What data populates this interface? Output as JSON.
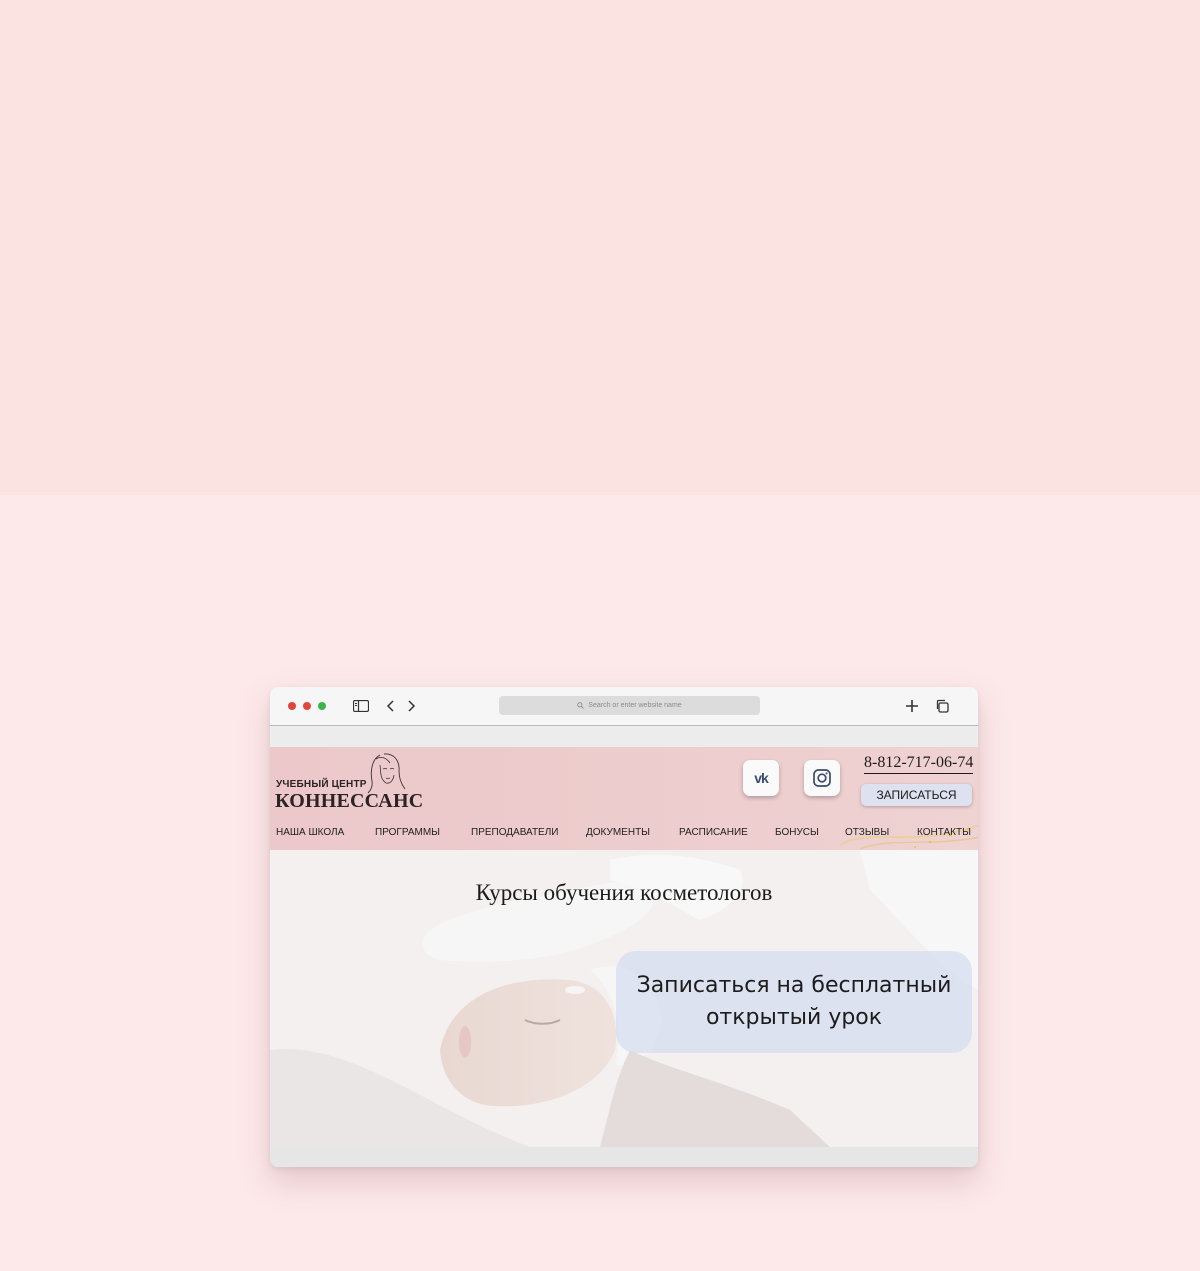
{
  "browser": {
    "address_placeholder": "Search or enter website name"
  },
  "site": {
    "logo_small": "УЧЕБНЫЙ ЦЕНТР",
    "logo_big": "КОННЕССАНС",
    "phone": "8-812-717-06-74",
    "signup_label": "ЗАПИСАТЬСЯ",
    "social": [
      "vk-icon",
      "instagram-icon"
    ],
    "nav": [
      "НАША ШКОЛА",
      "ПРОГРАММЫ",
      "ПРЕПОДАВАТЕЛИ",
      "ДОКУМЕНТЫ",
      "РАСПИСАНИЕ",
      "БОНУСЫ",
      "ОТЗЫВЫ",
      "КОНТАКТЫ"
    ]
  },
  "hero": {
    "title": "Курсы обучения косметологов",
    "cta": "Записаться на бесплатный открытый урок"
  },
  "colors": {
    "page_bg": "#fde9ea",
    "header_bg": "#edcccd",
    "cta_bg": "#d6def0"
  }
}
